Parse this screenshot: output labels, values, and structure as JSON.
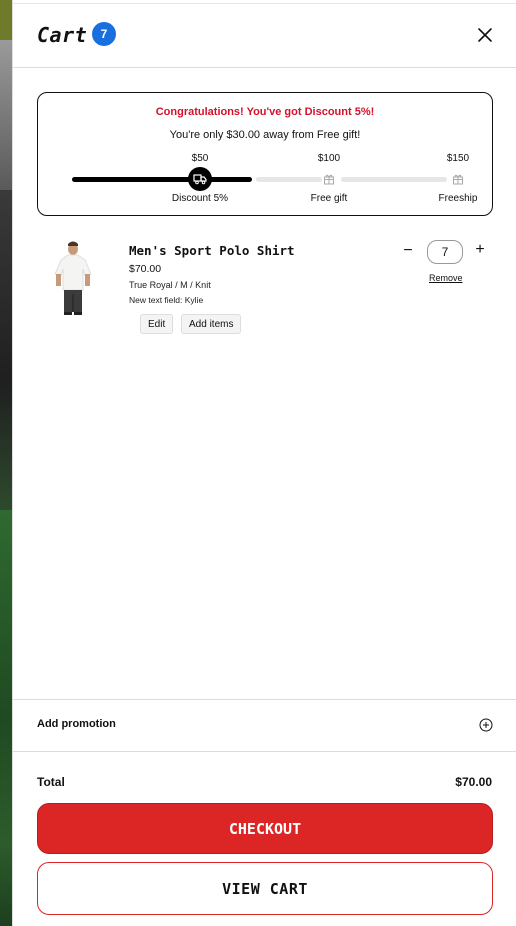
{
  "header": {
    "title": "Cart",
    "count": "7",
    "close_icon": "close-icon"
  },
  "progress": {
    "congrats_text": "Congratulations! You've got Discount 5%!",
    "away_text": "You're only $30.00 away from Free gift!",
    "fill_fraction": 0.5,
    "milestones": [
      {
        "amount": "$50",
        "label": "Discount 5%",
        "icon": "truck-icon",
        "reached": true
      },
      {
        "amount": "$100",
        "label": "Free gift",
        "icon": "gift-icon",
        "reached": false
      },
      {
        "amount": "$150",
        "label": "Freeship",
        "icon": "gift-icon",
        "reached": false
      }
    ],
    "accent_color": "#d4112a"
  },
  "item": {
    "name": "Men's Sport Polo Shirt",
    "price": "$70.00",
    "variant": "True Royal / M / Knit",
    "custom_field": "New text field: Kylie",
    "edit_label": "Edit",
    "add_items_label": "Add items",
    "quantity": "7",
    "minus_symbol": "−",
    "plus_symbol": "+",
    "remove_label": "Remove"
  },
  "promotion": {
    "label": "Add promotion"
  },
  "summary": {
    "total_label": "Total",
    "total_value": "$70.00"
  },
  "actions": {
    "checkout_label": "CHECKOUT",
    "view_cart_label": "VIEW CART",
    "checkout_color": "#dc2626"
  }
}
